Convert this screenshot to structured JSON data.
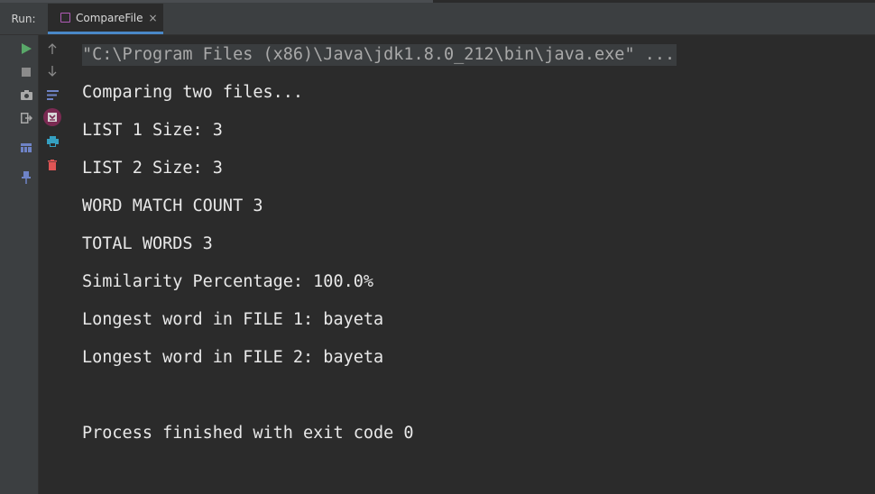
{
  "run_panel": {
    "label": "Run:",
    "tab_title": "CompareFile",
    "tab_close": "×"
  },
  "toolbar_left": [
    {
      "name": "rerun-icon",
      "glyph": "▶",
      "color": "#59a869"
    },
    {
      "name": "stop-icon",
      "glyph": "■",
      "color": "#8b8b8b"
    },
    {
      "name": "camera-icon",
      "glyph": "◘",
      "color": "#a9a9a9"
    },
    {
      "name": "exit-icon",
      "glyph": "⇥",
      "color": "#a9a9a9"
    },
    {
      "name": "layout-icon",
      "glyph": "▦",
      "color": "#6e83c6"
    },
    {
      "name": "pin-icon",
      "glyph": "📌",
      "color": "#6e83c6"
    }
  ],
  "toolbar_right": [
    {
      "name": "scroll-up-icon",
      "glyph": "↑",
      "color": "#8b8b8b"
    },
    {
      "name": "scroll-down-icon",
      "glyph": "↓",
      "color": "#8b8b8b"
    },
    {
      "name": "soft-wrap-icon",
      "glyph": "≡",
      "color": "#6e83c6"
    },
    {
      "name": "scroll-to-end-icon",
      "glyph": "⤓",
      "color": "#c75450"
    },
    {
      "name": "print-icon",
      "glyph": "⎙",
      "color": "#35a0c1"
    },
    {
      "name": "trash-icon",
      "glyph": "🗑",
      "color": "#e05555"
    }
  ],
  "console": {
    "command": "\"C:\\Program Files (x86)\\Java\\jdk1.8.0_212\\bin\\java.exe\" ...",
    "lines": [
      "Comparing two files...",
      "LIST 1 Size: 3",
      "LIST 2 Size: 3",
      "WORD MATCH COUNT 3",
      "TOTAL WORDS 3",
      "Similarity Percentage: 100.0%",
      "Longest word in FILE 1: bayeta",
      "Longest word in FILE 2: bayeta"
    ],
    "exit_message": "Process finished with exit code 0"
  }
}
